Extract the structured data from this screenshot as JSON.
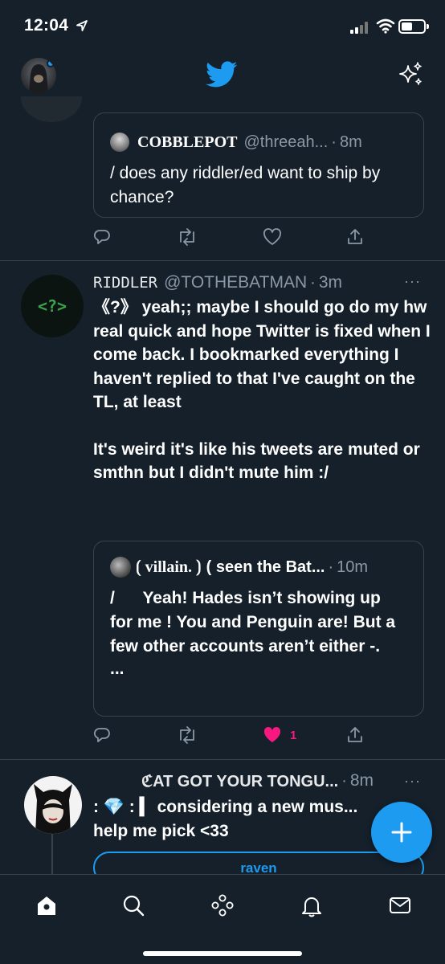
{
  "status_bar": {
    "time": "12:04"
  },
  "header": {
    "logo": "twitter-bird-icon",
    "sparkle": "sparkle-icon"
  },
  "quoted_tweet_1": {
    "name": "COBBLEPOT",
    "handle": "@threeah...",
    "dot": "·",
    "time": "8m",
    "text": "/ does any riddler/ed want to ship by chance?"
  },
  "tweet_riddler": {
    "avatar_text": "<?>",
    "name": "RIDDLER",
    "handle": "@TOTHEBATMAN",
    "dot": "·",
    "time": "3m",
    "more": "···",
    "text_p1": "《?》 yeah;; maybe I should go do my hw real quick and hope Twitter is fixed when I come back. I bookmarked everything I haven't replied to that I've caught on the TL, at least",
    "text_p2": "It's weird it's like his tweets are muted or smthn but I didn't mute him :/",
    "quote": {
      "name": "⟮ villain. ⟯",
      "handle": "( seen the Bat...",
      "dot": "·",
      "time": "10m",
      "text": "/      Yeah! Hades isn’t showing up for me ! You and Penguin are! But a few other accounts aren’t either -.",
      "ellipsis": "..."
    },
    "like_count": "1"
  },
  "tweet_cat": {
    "name": "ℭAT GOT YOUR TONGU...",
    "dot": "·",
    "time": "8m",
    "more": "···",
    "text_line1": ":  💎  :  ▍ considering a new mus...",
    "text_line2": "help me pick <33",
    "poll_option_1": "raven"
  },
  "colors": {
    "background": "#15202b",
    "accent": "#1d9bf0",
    "like": "#f91880",
    "muted": "#8b98a5",
    "border": "#38444d"
  }
}
